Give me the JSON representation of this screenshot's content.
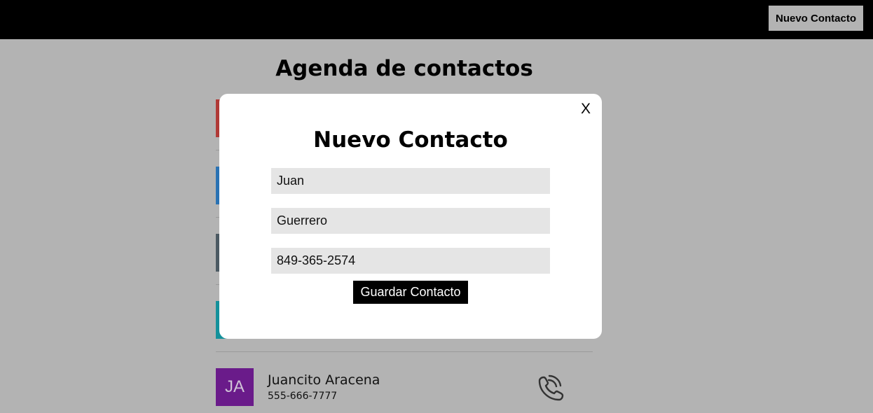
{
  "header": {
    "new_contact_button": "Nuevo Contacto"
  },
  "page": {
    "title": "Agenda de contactos"
  },
  "contacts": [
    {
      "color": "#b03a37"
    },
    {
      "color": "#2a72b3"
    },
    {
      "color": "#4c5a63"
    },
    {
      "color": "#14919b"
    },
    {
      "initials": "JA",
      "name": "Juancito Aracena",
      "phone": "555-666-7777",
      "color": "#6a1b8a",
      "icon": "phone-icon"
    }
  ],
  "modal": {
    "title": "Nuevo Contacto",
    "close_label": "X",
    "fields": {
      "first_name": "Juan",
      "last_name": "Guerrero",
      "phone": "849-365-2574"
    },
    "save_label": "Guardar Contacto"
  }
}
